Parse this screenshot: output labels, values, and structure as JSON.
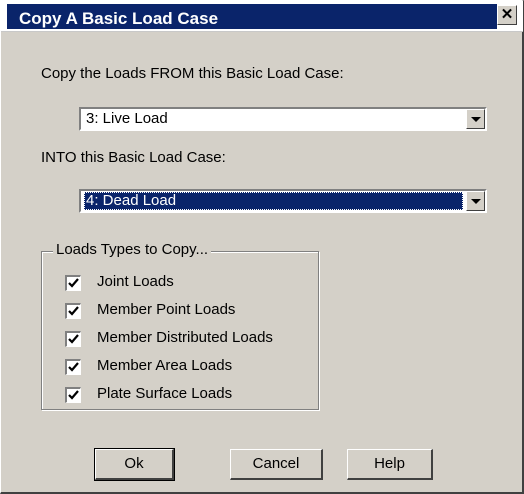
{
  "window": {
    "title": "Copy A Basic Load Case",
    "close_glyph": "✕"
  },
  "from": {
    "label": "Copy the Loads FROM this Basic Load Case:",
    "selected": "3: Live Load"
  },
  "into": {
    "label": "INTO this Basic Load Case:",
    "selected": "4: Dead Load"
  },
  "load_types": {
    "legend": "Loads Types to Copy...",
    "items": [
      {
        "label": "Joint Loads",
        "checked": true
      },
      {
        "label": "Member Point Loads",
        "checked": true
      },
      {
        "label": "Member Distributed Loads",
        "checked": true
      },
      {
        "label": "Member Area Loads",
        "checked": true
      },
      {
        "label": "Plate Surface Loads",
        "checked": true
      }
    ]
  },
  "buttons": {
    "ok": "Ok",
    "cancel": "Cancel",
    "help": "Help"
  },
  "colors": {
    "title_bar": "#0a246a",
    "dialog_face": "#d4d0c8",
    "selection": "#0a246a"
  }
}
